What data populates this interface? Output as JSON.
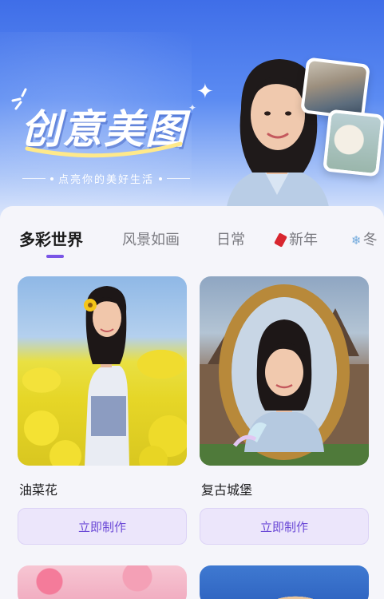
{
  "hero": {
    "brand_title": "创意美图",
    "brand_subtitle": "点亮你的美好生活"
  },
  "tabs": [
    {
      "label": "多彩世界",
      "active": true
    },
    {
      "label": "风景如画",
      "active": false
    },
    {
      "label": "日常",
      "active": false
    },
    {
      "label": "新年",
      "active": false,
      "icon": "red-envelope-icon"
    },
    {
      "label": "冬",
      "active": false,
      "icon": "snowflake-icon"
    }
  ],
  "cards": [
    {
      "name": "油菜花",
      "button_label": "立即制作"
    },
    {
      "name": "复古城堡",
      "button_label": "立即制作"
    }
  ],
  "colors": {
    "accent": "#7a55e6",
    "button_bg": "#ece6fb",
    "button_text": "#6a48d6",
    "hero_blue": "#3f6ee8"
  }
}
